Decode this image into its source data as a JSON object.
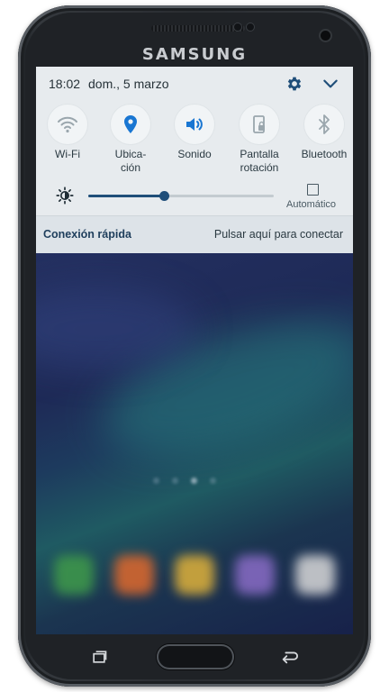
{
  "device": {
    "brand": "SAMSUNG"
  },
  "status": {
    "time": "18:02",
    "date": "dom., 5 marzo",
    "settings_icon": "gear-icon",
    "expand_icon": "chevron-down-icon"
  },
  "quick_toggles": [
    {
      "label": "Wi-Fi",
      "icon": "wifi-icon",
      "active": false
    },
    {
      "label": "Ubica-\nción",
      "icon": "location-icon",
      "active": true
    },
    {
      "label": "Sonido",
      "icon": "sound-icon",
      "active": true
    },
    {
      "label": "Pantalla\nrotación",
      "icon": "screen-rotation-icon",
      "active": false
    },
    {
      "label": "Bluetooth",
      "icon": "bluetooth-icon",
      "active": false
    }
  ],
  "brightness": {
    "level_percent": 41,
    "auto_label": "Automático",
    "auto_checked": false
  },
  "quick_connect": {
    "title": "Conexión rápida",
    "action": "Pulsar aquí para conectar"
  },
  "colors": {
    "panel_bg": "#e7ebee",
    "active_icon": "#1976d2",
    "inactive_icon": "#9aa6ad",
    "slider": "#1f4e79"
  }
}
